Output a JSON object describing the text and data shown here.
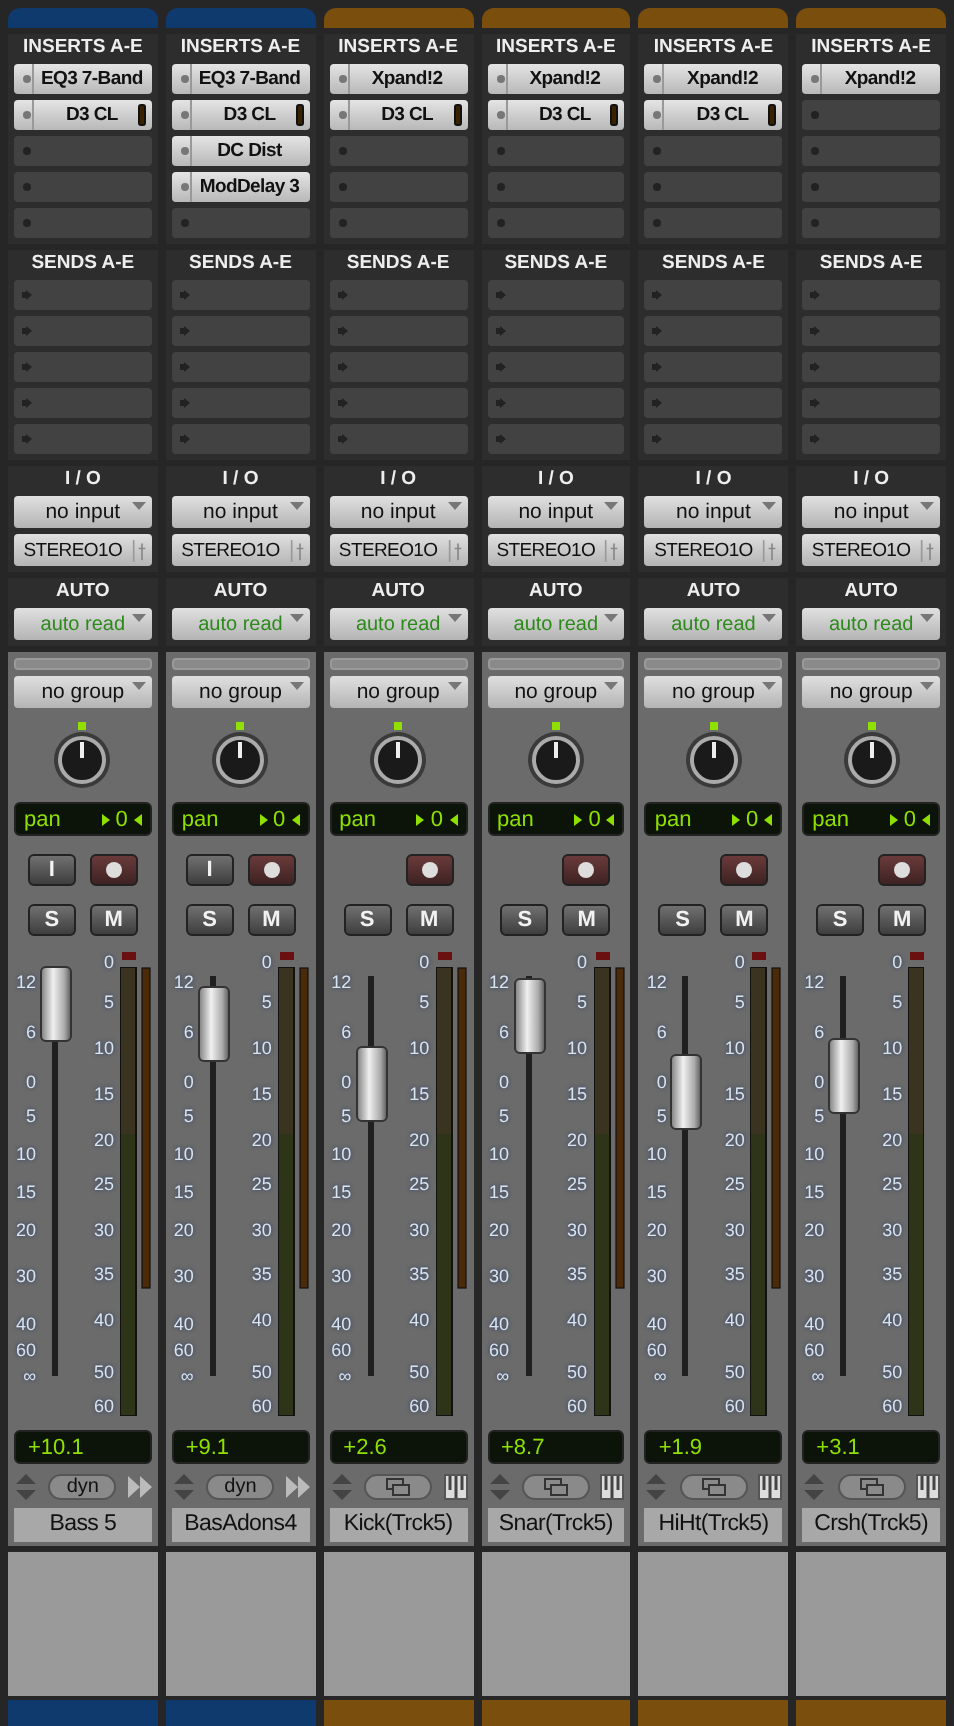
{
  "strips": [
    {
      "name": "Bass 5",
      "color": "#0f3a6e",
      "kind": "audio",
      "inserts": [
        {
          "name": "EQ3 7-Band",
          "gr_meter": false
        },
        {
          "name": "D3 CL",
          "gr_meter": true
        }
      ],
      "inserts_label": "INSERTS A-E",
      "sends_label": "SENDS A-E",
      "io_label": "I / O",
      "input": "no input",
      "output": "STEREO1O",
      "auto_label": "AUTO",
      "auto": "auto read",
      "group": "no group",
      "pan_label": "pan",
      "pan_value": "0",
      "input_button": "I",
      "solo": "S",
      "mute": "M",
      "level": 0.93,
      "stereo": true,
      "gain": "+10.1",
      "dyn": "dyn",
      "fader_scale": [
        "12",
        "6",
        "0",
        "5",
        "10",
        "15",
        "20",
        "30",
        "40",
        "60",
        "∞"
      ],
      "meter_scale": [
        "0",
        "5",
        "10",
        "15",
        "20",
        "25",
        "30",
        "35",
        "40",
        "50",
        "60"
      ]
    },
    {
      "name": "BasAdons4",
      "color": "#0f3a6e",
      "kind": "audio",
      "inserts": [
        {
          "name": "EQ3 7-Band",
          "gr_meter": false
        },
        {
          "name": "D3 CL",
          "gr_meter": true
        },
        {
          "name": "DC Dist",
          "gr_meter": false
        },
        {
          "name": "ModDelay 3",
          "gr_meter": false
        }
      ],
      "inserts_label": "INSERTS A-E",
      "sends_label": "SENDS A-E",
      "io_label": "I / O",
      "input": "no input",
      "output": "STEREO1O",
      "auto_label": "AUTO",
      "auto": "auto read",
      "group": "no group",
      "pan_label": "pan",
      "pan_value": "0",
      "input_button": "I",
      "solo": "S",
      "mute": "M",
      "level": 0.88,
      "stereo": true,
      "gain": "+9.1",
      "dyn": "dyn",
      "fader_scale": [
        "12",
        "6",
        "0",
        "5",
        "10",
        "15",
        "20",
        "30",
        "40",
        "60",
        "∞"
      ],
      "meter_scale": [
        "0",
        "5",
        "10",
        "15",
        "20",
        "25",
        "30",
        "35",
        "40",
        "50",
        "60"
      ]
    },
    {
      "name": "Kick(Trck5)",
      "color": "#7a4e0c",
      "kind": "instrument",
      "inserts": [
        {
          "name": "Xpand!2",
          "gr_meter": false
        },
        {
          "name": "D3 CL",
          "gr_meter": true
        }
      ],
      "inserts_label": "INSERTS A-E",
      "sends_label": "SENDS A-E",
      "io_label": "I / O",
      "input": "no input",
      "output": "STEREO1O",
      "auto_label": "AUTO",
      "auto": "auto read",
      "group": "no group",
      "pan_label": "pan",
      "pan_value": "0",
      "solo": "S",
      "mute": "M",
      "level": 0.73,
      "stereo": true,
      "gain": "+2.6",
      "fader_scale": [
        "12",
        "6",
        "0",
        "5",
        "10",
        "15",
        "20",
        "30",
        "40",
        "60",
        "∞"
      ],
      "meter_scale": [
        "0",
        "5",
        "10",
        "15",
        "20",
        "25",
        "30",
        "35",
        "40",
        "50",
        "60"
      ]
    },
    {
      "name": "Snar(Trck5)",
      "color": "#7a4e0c",
      "kind": "instrument",
      "inserts": [
        {
          "name": "Xpand!2",
          "gr_meter": false
        },
        {
          "name": "D3 CL",
          "gr_meter": true
        }
      ],
      "inserts_label": "INSERTS A-E",
      "sends_label": "SENDS A-E",
      "io_label": "I / O",
      "input": "no input",
      "output": "STEREO1O",
      "auto_label": "AUTO",
      "auto": "auto read",
      "group": "no group",
      "pan_label": "pan",
      "pan_value": "0",
      "solo": "S",
      "mute": "M",
      "level": 0.9,
      "stereo": true,
      "gain": "+8.7",
      "fader_scale": [
        "12",
        "6",
        "0",
        "5",
        "10",
        "15",
        "20",
        "30",
        "40",
        "60",
        "∞"
      ],
      "meter_scale": [
        "0",
        "5",
        "10",
        "15",
        "20",
        "25",
        "30",
        "35",
        "40",
        "50",
        "60"
      ]
    },
    {
      "name": "HiHt(Trck5)",
      "color": "#7a4e0c",
      "kind": "instrument",
      "inserts": [
        {
          "name": "Xpand!2",
          "gr_meter": false
        },
        {
          "name": "D3 CL",
          "gr_meter": true
        }
      ],
      "inserts_label": "INSERTS A-E",
      "sends_label": "SENDS A-E",
      "io_label": "I / O",
      "input": "no input",
      "output": "STEREO1O",
      "auto_label": "AUTO",
      "auto": "auto read",
      "group": "no group",
      "pan_label": "pan",
      "pan_value": "0",
      "solo": "S",
      "mute": "M",
      "level": 0.71,
      "stereo": true,
      "gain": "+1.9",
      "fader_scale": [
        "12",
        "6",
        "0",
        "5",
        "10",
        "15",
        "20",
        "30",
        "40",
        "60",
        "∞"
      ],
      "meter_scale": [
        "0",
        "5",
        "10",
        "15",
        "20",
        "25",
        "30",
        "35",
        "40",
        "50",
        "60"
      ]
    },
    {
      "name": "Crsh(Trck5)",
      "color": "#7a4e0c",
      "kind": "instrument",
      "inserts": [
        {
          "name": "Xpand!2",
          "gr_meter": false
        }
      ],
      "inserts_label": "INSERTS A-E",
      "sends_label": "SENDS A-E",
      "io_label": "I / O",
      "input": "no input",
      "output": "STEREO1O",
      "auto_label": "AUTO",
      "auto": "auto read",
      "group": "no group",
      "pan_label": "pan",
      "pan_value": "0",
      "solo": "S",
      "mute": "M",
      "level": 0.75,
      "stereo": false,
      "gain": "+3.1",
      "fader_scale": [
        "12",
        "6",
        "0",
        "5",
        "10",
        "15",
        "20",
        "30",
        "40",
        "60",
        "∞"
      ],
      "meter_scale": [
        "0",
        "5",
        "10",
        "15",
        "20",
        "25",
        "30",
        "35",
        "40",
        "50",
        "60"
      ]
    }
  ]
}
